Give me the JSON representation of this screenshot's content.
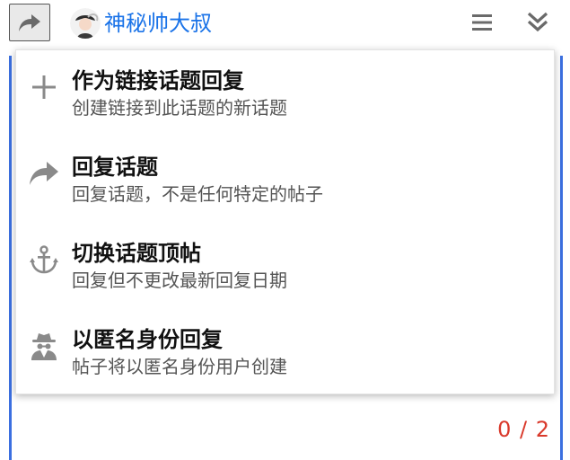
{
  "header": {
    "reply_icon": "share-arrow-icon",
    "username": "神秘帅大叔",
    "menu_icon": "hamburger-icon",
    "collapse_icon": "double-chevron-down-icon"
  },
  "dropdown": {
    "items": [
      {
        "icon": "plus-icon",
        "title": "作为链接话题回复",
        "desc": "创建链接到此话题的新话题"
      },
      {
        "icon": "share-arrow-icon",
        "title": "回复话题",
        "desc": "回复话题，不是任何特定的帖子"
      },
      {
        "icon": "anchor-icon",
        "title": "切换话题顶帖",
        "desc": "回复但不更改最新回复日期"
      },
      {
        "icon": "spy-icon",
        "title": "以匿名身份回复",
        "desc": "帖子将以匿名身份用户创建"
      }
    ]
  },
  "composer": {
    "char_count": "0 / 2"
  },
  "colors": {
    "accent": "#1a73e8",
    "border": "#3b6fe0",
    "counter": "#d9392b",
    "icon": "#8a8a8a"
  }
}
